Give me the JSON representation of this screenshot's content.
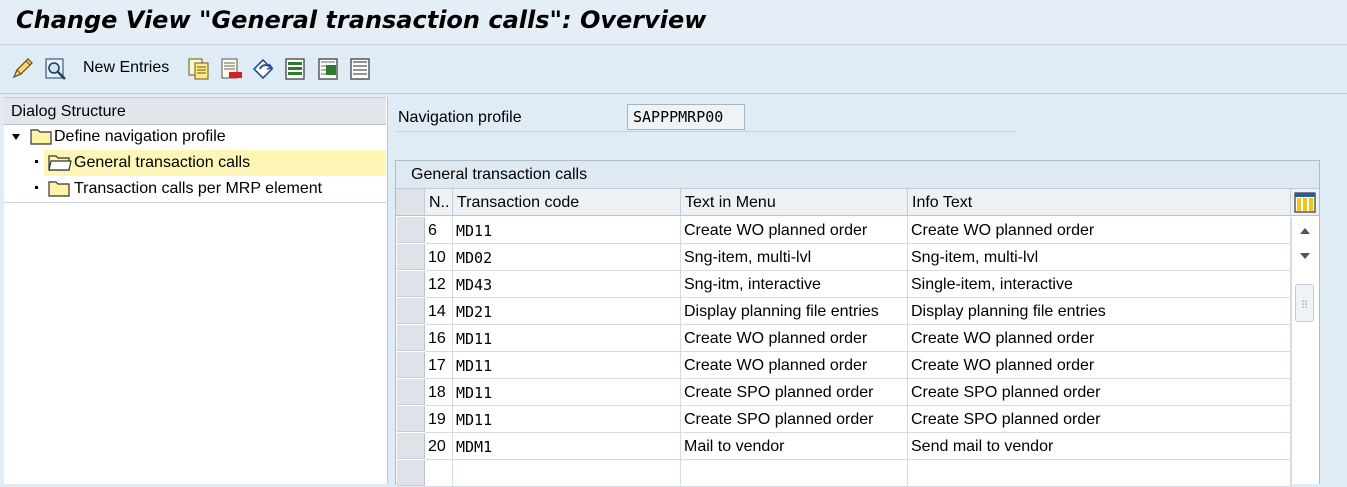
{
  "title": "Change View \"General transaction calls\": Overview",
  "toolbar": {
    "new_entries_label": "New Entries",
    "icons": [
      "edit-pencil-icon",
      "display-glasses-icon",
      "copy-icon",
      "delete-icon",
      "undo-change-icon",
      "select-all-icon",
      "select-block-icon",
      "deselect-all-icon"
    ]
  },
  "dialog_structure": {
    "header": "Dialog Structure",
    "items": [
      {
        "label": "Define navigation profile",
        "level": 0,
        "expanded": true
      },
      {
        "label": "General transaction calls",
        "level": 1,
        "selected": true
      },
      {
        "label": "Transaction calls per MRP element",
        "level": 1
      }
    ]
  },
  "navigation_profile": {
    "label": "Navigation profile",
    "value": "SAPPPMRP00"
  },
  "table": {
    "title": "General transaction calls",
    "columns": [
      "N..",
      "Transaction code",
      "Text in Menu",
      "Info Text"
    ],
    "rows": [
      [
        "6",
        "MD11",
        "Create WO planned order",
        "Create WO planned order"
      ],
      [
        "10",
        "MD02",
        "Sng-item, multi-lvl",
        "Sng-item, multi-lvl"
      ],
      [
        "12",
        "MD43",
        "Sng-itm, interactive",
        "Single-item, interactive"
      ],
      [
        "14",
        "MD21",
        "Display planning file entries",
        "Display planning file entries"
      ],
      [
        "16",
        "MD11",
        "Create WO planned order",
        "Create WO planned order"
      ],
      [
        "17",
        "MD11",
        "Create WO planned order",
        "Create WO planned order"
      ],
      [
        "18",
        "MD11",
        "Create SPO planned order",
        "Create SPO planned order"
      ],
      [
        "19",
        "MD11",
        "Create SPO planned order",
        "Create SPO planned order"
      ],
      [
        "20",
        "MDM1",
        "Mail to vendor",
        "Send mail to vendor"
      ]
    ]
  },
  "colors": {
    "background": "#dfebf5",
    "selected_tree_item": "#fdf6b6",
    "folder_yellow": "#fff3a8"
  }
}
